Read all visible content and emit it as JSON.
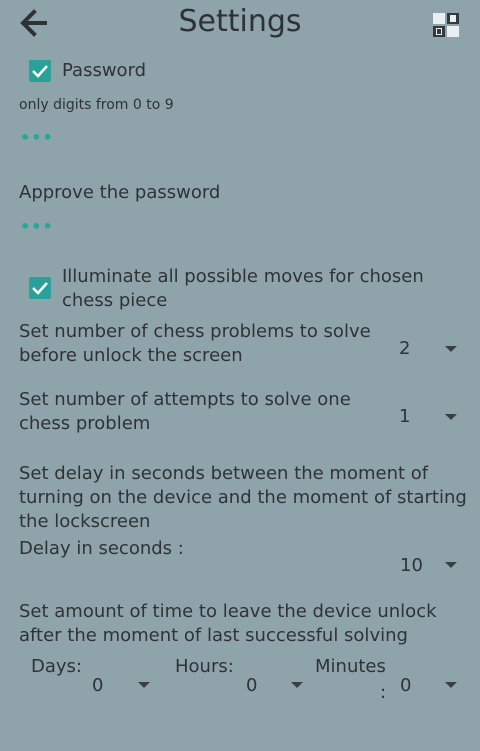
{
  "header": {
    "title": "Settings"
  },
  "password": {
    "checkbox_label": "Password",
    "checked": true,
    "hint": "only digits from 0 to 9",
    "value": "•••"
  },
  "approve": {
    "label": "Approve the password",
    "value": "•••"
  },
  "illuminate": {
    "label_line1": "Illuminate all possible moves for chosen",
    "label_line2": "chess piece",
    "checked": true
  },
  "problems": {
    "label_line1": "Set number of chess problems to solve",
    "label_line2": "before unlock the screen",
    "selected": "2"
  },
  "attempts": {
    "label_line1": "Set number of attempts to solve one",
    "label_line2": "chess problem",
    "selected": "1"
  },
  "delay": {
    "label_line1": "Set delay in seconds between the moment of",
    "label_line2": "turning on the device and the moment of starting",
    "label_line3": "the lockscreen",
    "sub_label": "Delay in seconds :",
    "selected": "10"
  },
  "unlock_time": {
    "label_line1": "Set amount of time to leave the device unlock",
    "label_line2": "after the moment of last successful solving",
    "days_label": "Days:",
    "days_value": "0",
    "hours_label": "Hours:",
    "hours_value": "0",
    "minutes_label": "Minutes",
    "colon": ":",
    "minutes_value": "0"
  },
  "colors": {
    "background": "#8fa3ab",
    "accent": "#2aa198",
    "text": "#2f3336"
  },
  "icons": [
    "arrow-left-icon",
    "app-icon",
    "check-icon",
    "caret-down-icon"
  ]
}
